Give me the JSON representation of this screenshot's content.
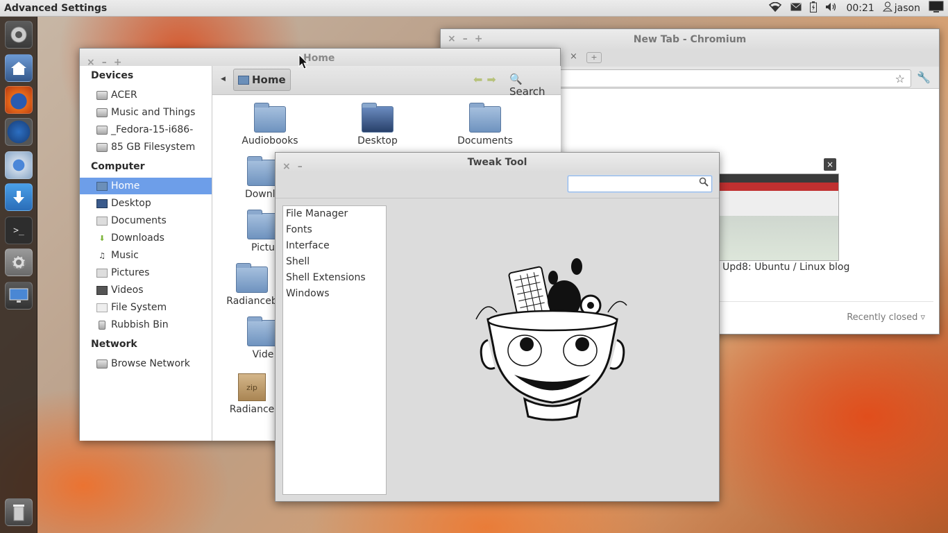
{
  "top_panel": {
    "app_title": "Advanced Settings",
    "time": "00:21",
    "user": "jason",
    "icons": [
      "wifi-icon",
      "mail-icon",
      "battery-icon",
      "volume-icon",
      "user-icon",
      "session-icon"
    ]
  },
  "launcher": {
    "items": [
      "dash-icon",
      "home-folder-icon",
      "firefox-icon",
      "thunderbird-icon",
      "chromium-icon",
      "download-icon",
      "terminal-icon",
      "settings-icon",
      "display-icon",
      "trash-icon"
    ]
  },
  "chromium": {
    "title": "New Tab - Chromium",
    "thumbnail_caption": "Upd8: Ubuntu / Linux blog",
    "recently_closed": "Recently closed"
  },
  "nautilus": {
    "title": "Home",
    "path_button": "Home",
    "search_label": "Search",
    "sidebar": {
      "devices_header": "Devices",
      "devices": [
        "ACER",
        "Music and Things",
        "_Fedora-15-i686-",
        "85 GB Filesystem"
      ],
      "computer_header": "Computer",
      "computer": [
        "Home",
        "Desktop",
        "Documents",
        "Downloads",
        "Music",
        "Pictures",
        "Videos",
        "File System",
        "Rubbish Bin"
      ],
      "network_header": "Network",
      "network": [
        "Browse Network"
      ]
    },
    "files": [
      "Audiobooks",
      "Desktop",
      "Documents",
      "Downlo",
      "Pictu",
      "Radianceb",
      "Vide",
      "Radiance"
    ],
    "zip_label": "zip"
  },
  "tweak_tool": {
    "title": "Tweak Tool",
    "search_placeholder": "",
    "categories": [
      "File Manager",
      "Fonts",
      "Interface",
      "Shell",
      "Shell Extensions",
      "Windows"
    ]
  },
  "colors": {
    "selection": "#6d9ee9",
    "launcher_bg": "#2a201b",
    "panel_bg": "#dcdcdc"
  }
}
